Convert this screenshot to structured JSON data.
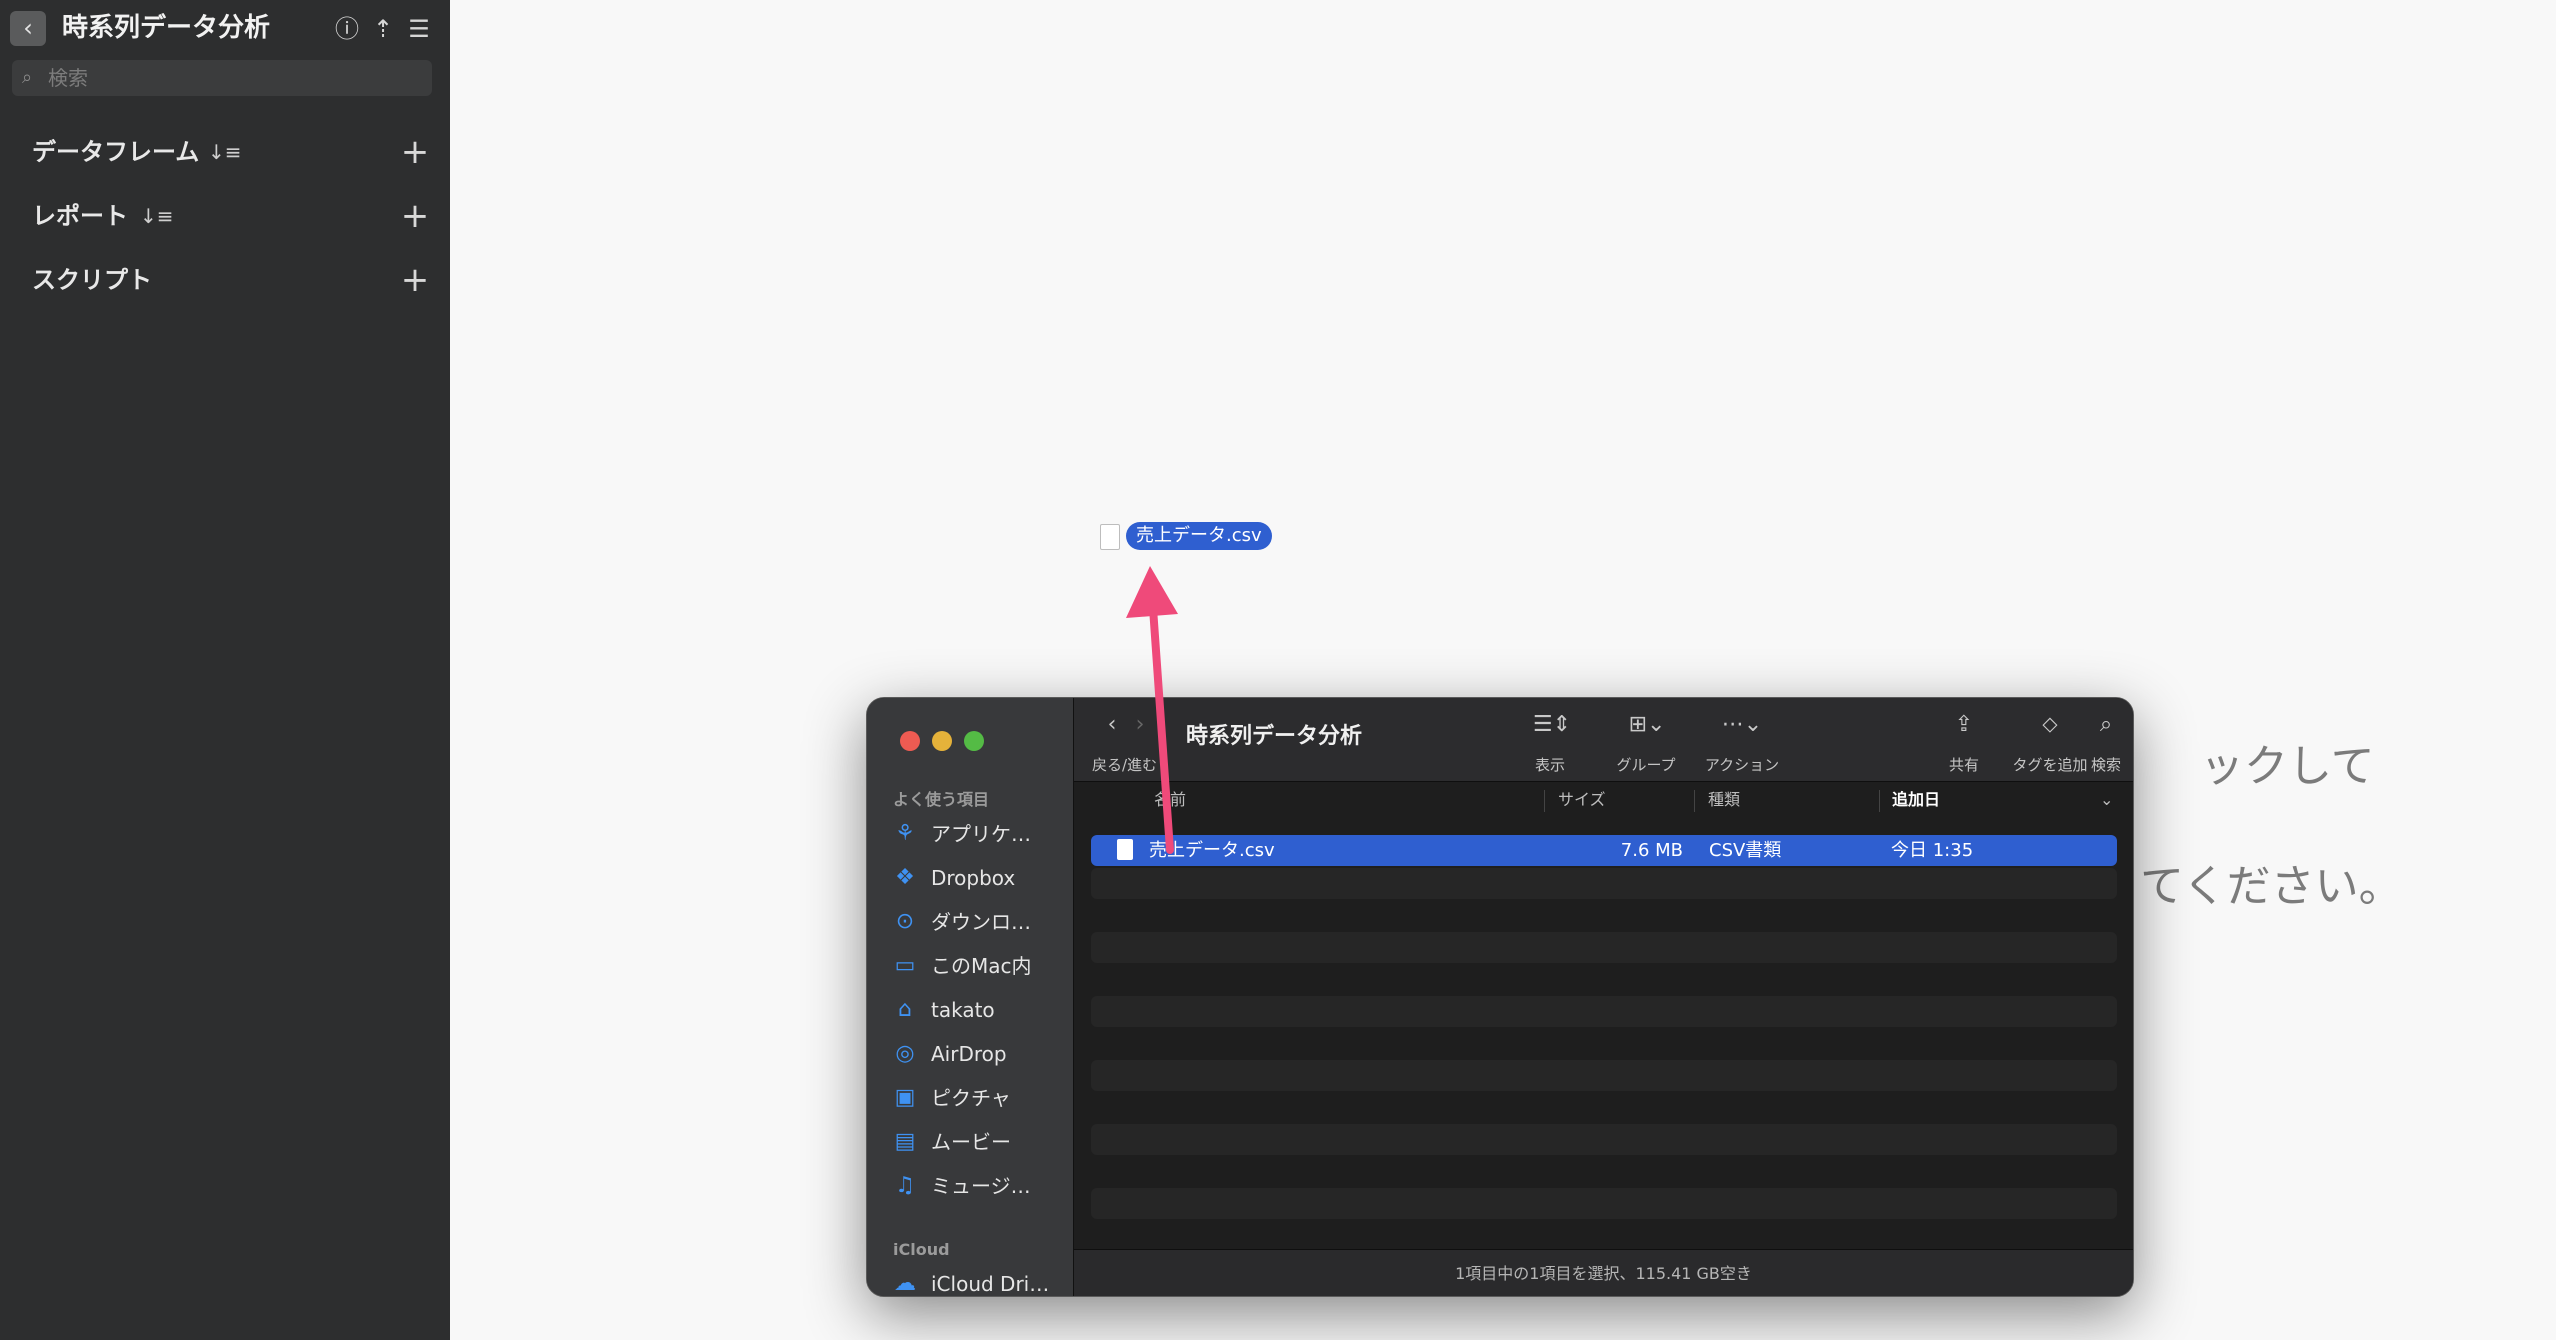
{
  "app": {
    "title": "時系列データ分析",
    "search_placeholder": "検索",
    "sections": [
      {
        "label": "データフレーム",
        "sortable": true
      },
      {
        "label": "レポート",
        "sortable": true
      },
      {
        "label": "スクリプト",
        "sortable": false
      }
    ],
    "header_icons": [
      "info-icon",
      "share-icon",
      "menu-icon"
    ]
  },
  "background_hint": {
    "line1": "ックして",
    "line2": "てください。"
  },
  "dragged_file": {
    "name": "売上データ.csv"
  },
  "finder": {
    "title": "時系列データ分析",
    "toolbar": {
      "nav_label": "戻る/進む",
      "view_label": "表示",
      "group_label": "グループ",
      "action_label": "アクション",
      "share_label": "共有",
      "tag_label": "タグを追加",
      "search_label": "検索"
    },
    "sidebar": {
      "favorites_heading": "よく使う項目",
      "items": [
        {
          "label": "アプリケ…",
          "icon": "applications-icon"
        },
        {
          "label": "Dropbox",
          "icon": "dropbox-icon"
        },
        {
          "label": "ダウンロ…",
          "icon": "downloads-icon"
        },
        {
          "label": "このMac内",
          "icon": "folder-icon"
        },
        {
          "label": "takato",
          "icon": "home-icon"
        },
        {
          "label": "AirDrop",
          "icon": "airdrop-icon"
        },
        {
          "label": "ピクチャ",
          "icon": "pictures-icon"
        },
        {
          "label": "ムービー",
          "icon": "movies-icon"
        },
        {
          "label": "ミュージ…",
          "icon": "music-icon"
        }
      ],
      "icloud_heading": "iCloud",
      "icloud_items": [
        {
          "label": "iCloud Dri…",
          "icon": "cloud-icon"
        }
      ]
    },
    "columns": {
      "name": "名前",
      "size": "サイズ",
      "kind": "種類",
      "date_added": "追加日"
    },
    "files": [
      {
        "name": "売上データ.csv",
        "size": "7.6 MB",
        "kind": "CSV書類",
        "date_added": "今日 1:35",
        "selected": true
      }
    ],
    "status": "1項目中の1項目を選択、115.41 GB空き"
  },
  "colors": {
    "selection_blue": "#2f5fd0",
    "annotation_arrow": "#ef4a7a",
    "sidebar_icon_blue": "#3f92f2"
  }
}
